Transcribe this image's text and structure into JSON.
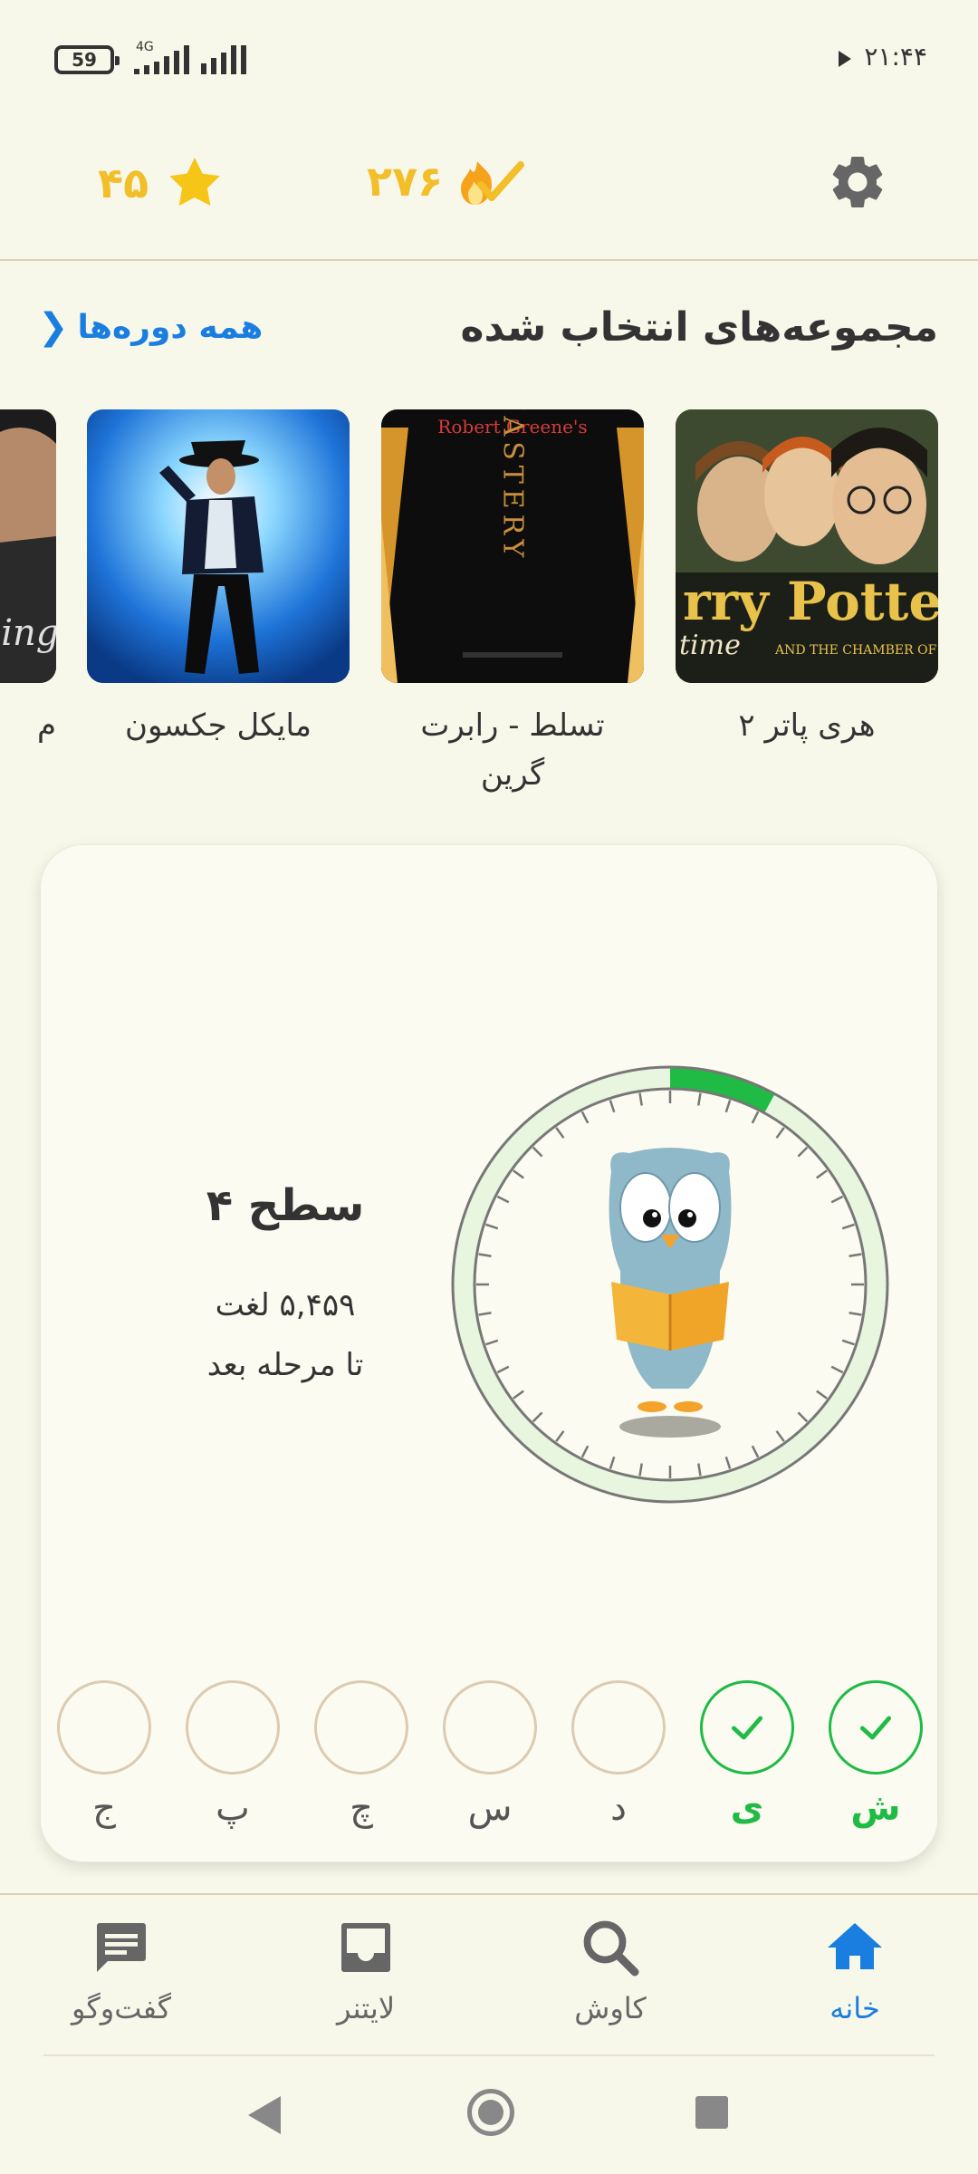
{
  "status_bar": {
    "battery": "59",
    "network": "4G",
    "time": "۲۱:۴۴"
  },
  "header": {
    "stars": "۴۵",
    "streak": "۲۷۶"
  },
  "section": {
    "title": "مجموعه‌های انتخاب شده",
    "all_courses": "همه دوره‌ها",
    "all_courses_chevron": "❮"
  },
  "courses": [
    {
      "title": "هری پاتر ۲",
      "cover_text": "rry Potter",
      "cover_subtext": "time",
      "cover_caption": "AND THE CHAMBER OF SEC"
    },
    {
      "title": "تسلط - رابرت گرین",
      "cover_text": "Robert Greene's",
      "cover_subtext": "MASTERY"
    },
    {
      "title": "مایکل جکسون"
    },
    {
      "title": "م",
      "cover_text": "king"
    }
  ],
  "level": {
    "title": "سطح ۴",
    "words": "۵,۴۵۹ لغت",
    "next": "تا مرحله بعد",
    "progress_fraction": 0.08
  },
  "letters": [
    {
      "char": "ش",
      "done": true
    },
    {
      "char": "ی",
      "done": true
    },
    {
      "char": "د",
      "done": false
    },
    {
      "char": "س",
      "done": false
    },
    {
      "char": "چ",
      "done": false
    },
    {
      "char": "پ",
      "done": false
    },
    {
      "char": "ج",
      "done": false
    }
  ],
  "bottom_nav": [
    {
      "label": "خانه",
      "icon": "home-icon",
      "active": true
    },
    {
      "label": "کاوش",
      "icon": "search-icon",
      "active": false
    },
    {
      "label": "لایتنر",
      "icon": "inbox-icon",
      "active": false
    },
    {
      "label": "گفت‌وگو",
      "icon": "chat-icon",
      "active": false
    }
  ],
  "colors": {
    "accent": "#1a7ee0",
    "gold": "#f2bf2a",
    "success": "#1fbb45",
    "background": "#f8f8ea"
  }
}
